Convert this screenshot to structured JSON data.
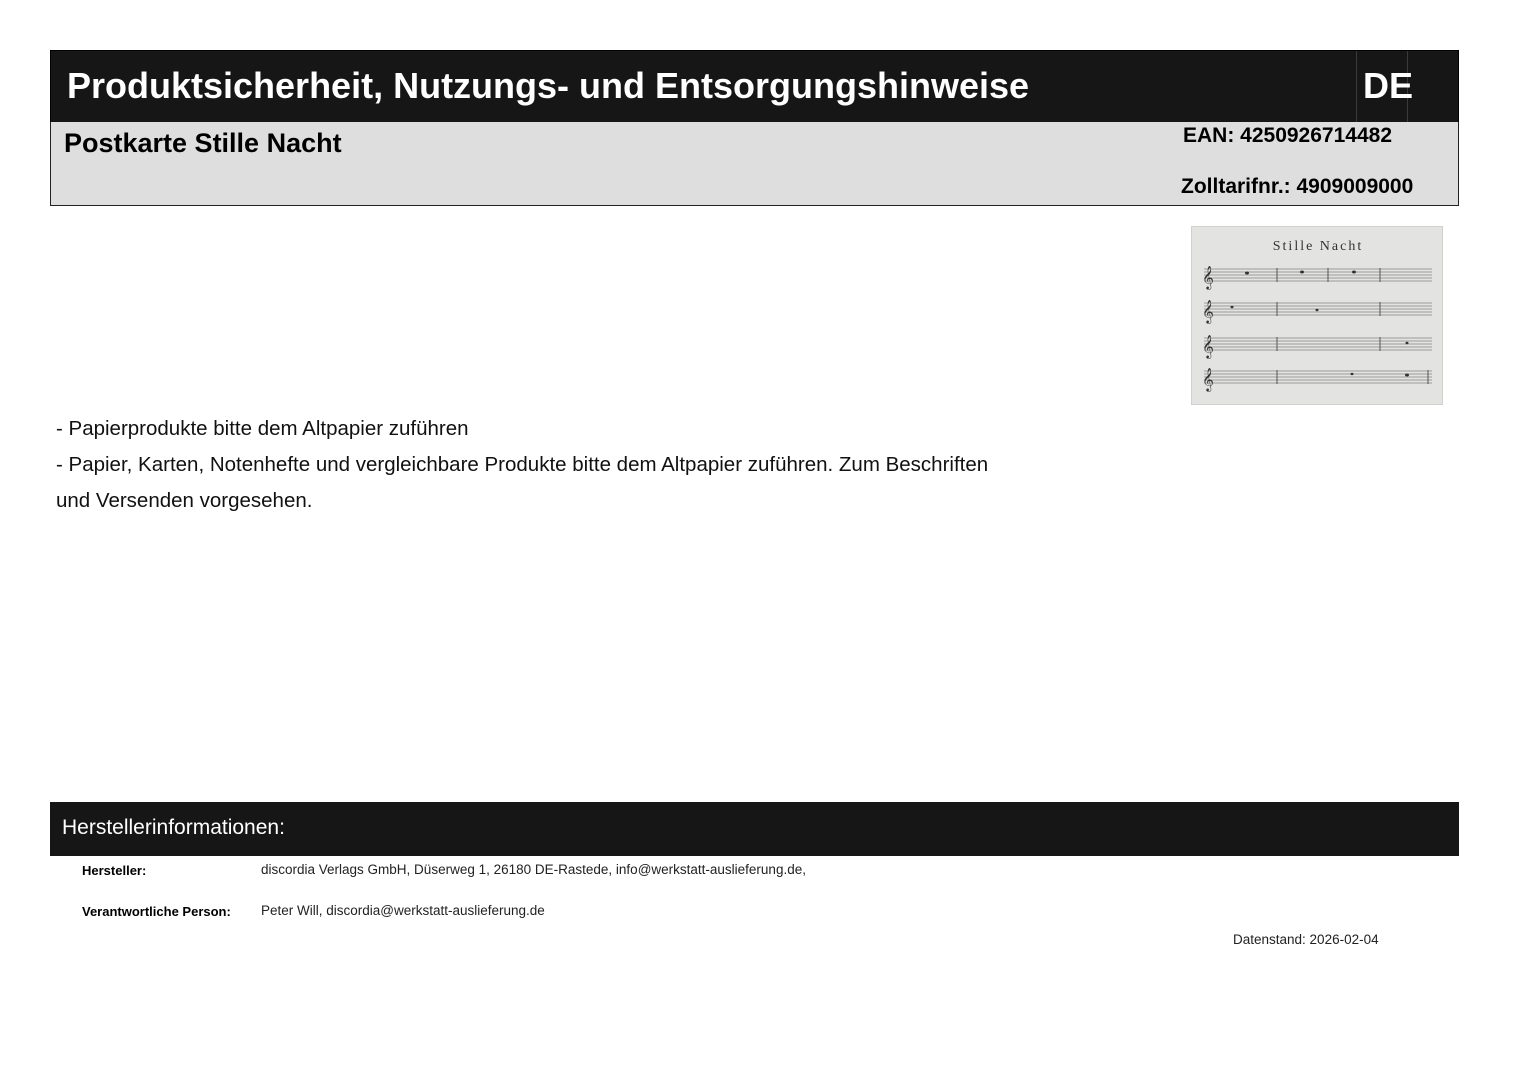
{
  "header": {
    "title": "Produktsicherheit, Nutzungs- und Entsorgungshinweise",
    "language": "DE"
  },
  "product": {
    "name": "Postkarte Stille Nacht",
    "ean": "EAN: 4250926714482",
    "tariff": "Zolltarifnr.: 4909009000",
    "image": {
      "description_icon": "sheet-music-image",
      "title": "Stille Nacht"
    }
  },
  "hints": {
    "line1": "- Papierprodukte bitte dem Altpapier zuführen",
    "line2": "- Papier, Karten, Notenhefte und vergleichbare Produkte bitte dem Altpapier zuführen. Zum Beschriften",
    "line3": "und Versenden vorgesehen."
  },
  "manufacturer": {
    "section_title": "Herstellerinformationen:",
    "maker_label": "Hersteller:",
    "maker_value": "discordia Verlags GmbH, Düserweg 1, 26180 DE-Rastede, info@werkstatt-auslieferung.de,",
    "person_label": "Verantwortliche Person:",
    "person_value": "Peter Will, discordia@werkstatt-auslieferung.de",
    "date": "Datenstand: 2026-02-04"
  }
}
